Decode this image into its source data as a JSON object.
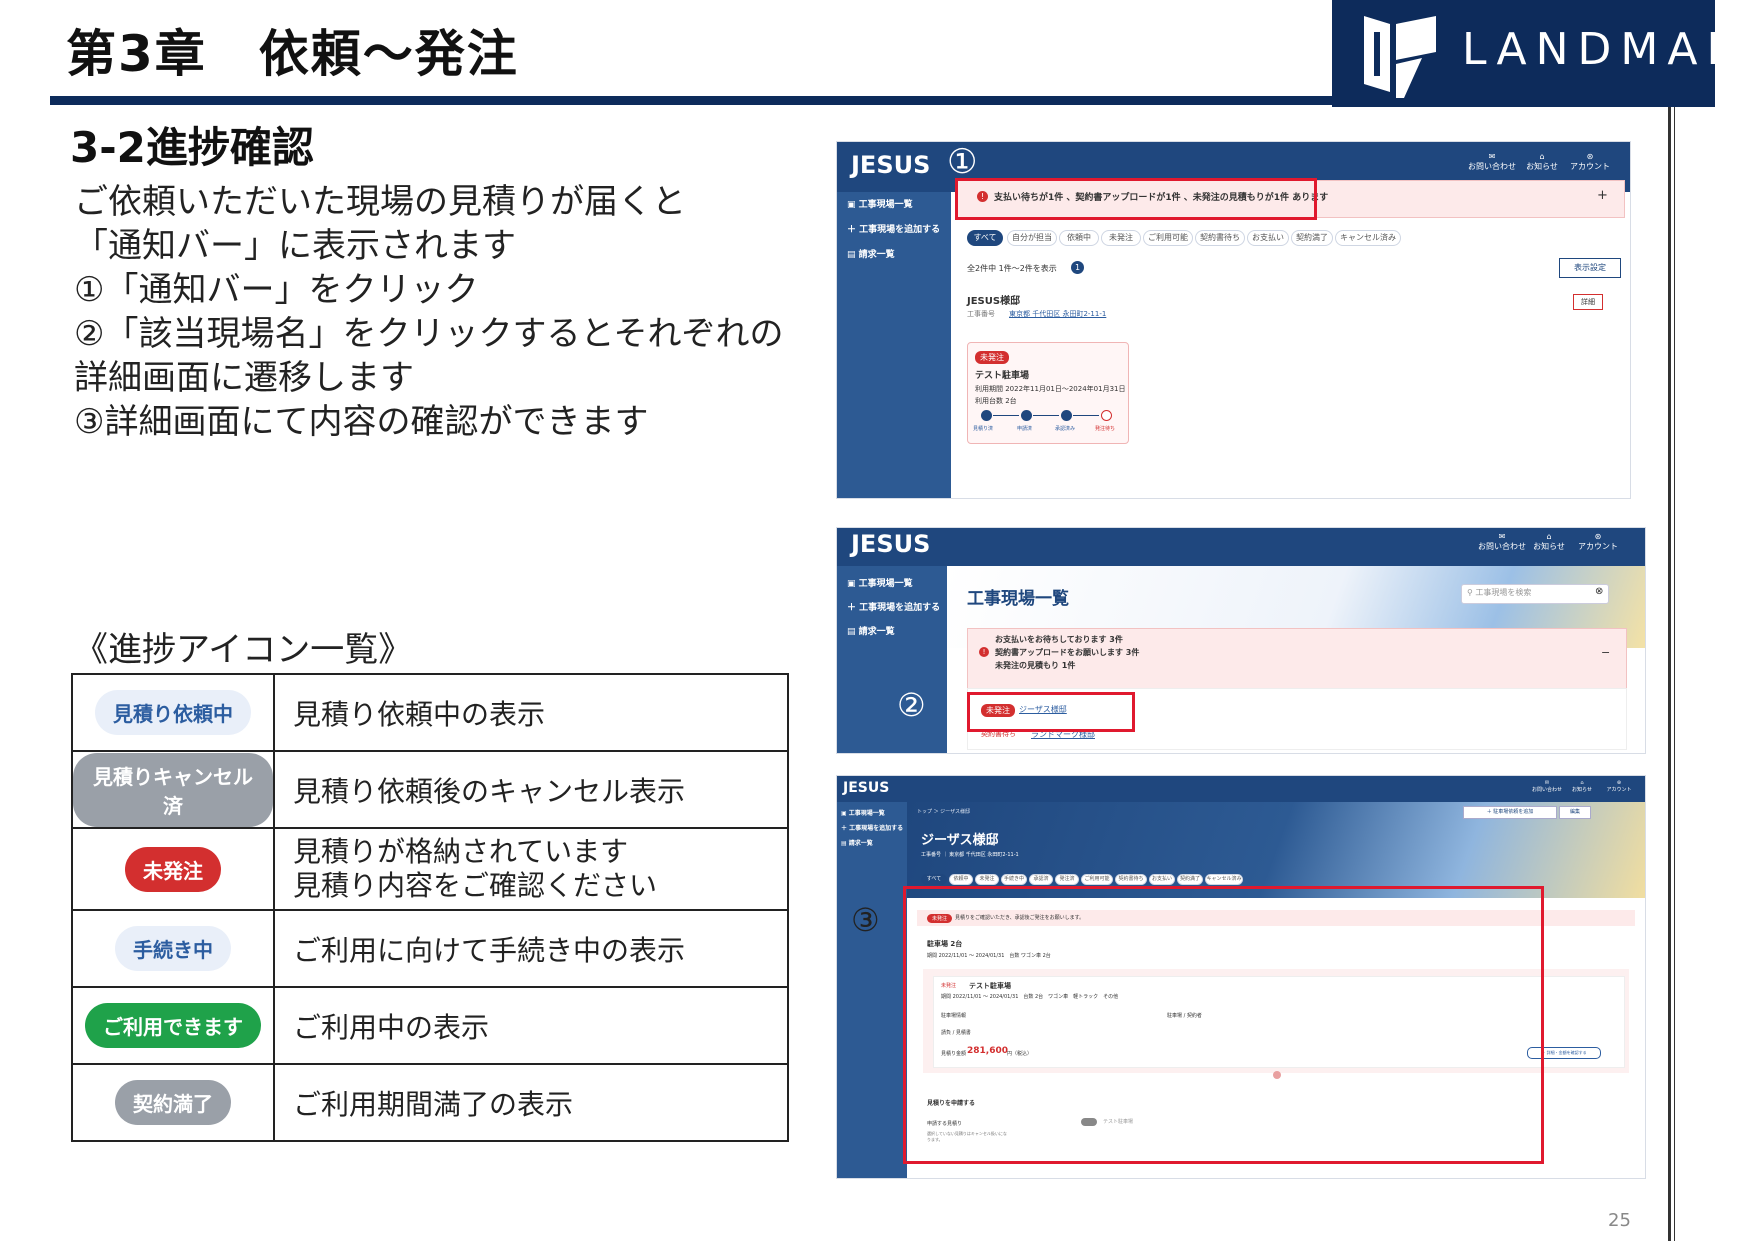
{
  "header": {
    "chapter_title": "第3章　依頼～発注",
    "logo_text": "LANDMARK",
    "logo_icon": "landmark-book-icon",
    "brand_color": "#0d2b5b"
  },
  "section_title": "3-2進捗確認",
  "description": [
    "ご依頼いただいた現場の見積りが届くと",
    "「通知バー」に表示されます",
    "①「通知バー」をクリック",
    "②「該当現場名」をクリックするとそれぞれの",
    "詳細画面に遷移します",
    "③詳細画面にて内容の確認ができます"
  ],
  "legend_title": "《進捗アイコン一覧》",
  "legend_rows": [
    {
      "badge": "見積り依頼中",
      "badge_color": "#eef3fb",
      "badge_text_color": "#2c5da0",
      "meaning": "見積り依頼中の表示"
    },
    {
      "badge": "見積りキャンセル済",
      "badge_color": "#9aa0a8",
      "badge_text_color": "#ffffff",
      "meaning": "見積り依頼後のキャンセル表示"
    },
    {
      "badge": "未発注",
      "badge_color": "#d32f2f",
      "badge_text_color": "#ffffff",
      "meaning": "見積りが格納されています",
      "meaning2": "見積り内容をご確認ください"
    },
    {
      "badge": "手続き中",
      "badge_color": "#eef3fb",
      "badge_text_color": "#2c5da0",
      "meaning": "ご利用に向けて手続き中の表示"
    },
    {
      "badge": "ご利用できます",
      "badge_color": "#1fa24a",
      "badge_text_color": "#ffffff",
      "meaning": "ご利用中の表示"
    },
    {
      "badge": "契約満了",
      "badge_color": "#9aa0a8",
      "badge_text_color": "#ffffff",
      "meaning": "ご利用期間満了の表示"
    }
  ],
  "screens": {
    "brand": "JESUS",
    "nav_contact": "お問い合わせ",
    "nav_notice": "お知らせ",
    "nav_account": "アカウント",
    "side_items": [
      "工事現場一覧",
      "工事現場を追加する",
      "請求一覧"
    ],
    "screen1": {
      "step_marker": "①",
      "notification": "支払い待ちが1件 、契約書アップロードが1件 、未発注の見積もりが1件 あります",
      "plus": "+",
      "tabs": [
        "すべて",
        "自分が担当",
        "依頼中",
        "未発注",
        "ご利用可能",
        "契約書待ち",
        "お支払い",
        "契約満了",
        "キャンセル済み"
      ],
      "count_text": "全2件中 1件～2件を表示",
      "count_badge": "1",
      "display_settings": "表示設定",
      "site_name": "JESUS様邸",
      "site_no_label": "工事番号",
      "site_address": "東京都 千代田区 永田町2-11-1",
      "detail_button": "詳細",
      "card_badge": "未発注",
      "card_title": "テスト駐車場",
      "card_period": "利用期間 2022年11月01日～2024年01月31日",
      "card_count": "利用台数 2台",
      "steps": [
        "見積り済",
        "申請済",
        "承認済み",
        "発注待ち"
      ]
    },
    "screen2": {
      "step_marker": "②",
      "page_title": "工事現場一覧",
      "search_placeholder": "工事現場を検索",
      "notice_lines": [
        "お支払いをお待ちしております 3件",
        "契約書アップロードをお願いします 3件",
        "未発注の見積もり 1件"
      ],
      "collapse": "−",
      "row1_badge": "未発注",
      "row1_site": "ジーザス様邸",
      "row2_badge": "契約書待ち",
      "row2_site": "ランドマーク様邸"
    },
    "screen3": {
      "step_marker": "③",
      "breadcrumb": "トップ ＞ ジーザス様邸",
      "btn_add": "＋ 駐車場依頼を追加",
      "btn_edit": "編集",
      "page_title": "ジーザス様邸",
      "sub_info": "工事番号 ｜ 東京都 千代田区 永田町2-11-1",
      "tabs": [
        "すべて",
        "依頼中",
        "未発注",
        "手続き中",
        "承認済",
        "発注済",
        "ご利用可能",
        "契約書待ち",
        "お支払い",
        "契約満了",
        "キャンセル済み"
      ],
      "alert_badge": "未発注",
      "alert_text": "見積りをご確認いただき、承認後ご発注をお願いします。",
      "req_title": "駐車場 2台",
      "req_dates": "期間 2022/11/01 ～ 2024/01/31　台数 ワゴン車 2台",
      "quote_badge": "未発注",
      "quote_title": "テスト駐車場",
      "quote_detail": "期間 2022/11/01 ～ 2024/01/31　台数 2台　ワゴン車　軽トラック　その他",
      "field1": "駐車場情報",
      "field2": "駐車場 / 契約者",
      "field3": "請負 / 見積書",
      "total_label": "見積り金額",
      "total_value": "281,600",
      "total_unit": "円（税込）",
      "detail_link": "＋ 詳細・金額を確認する",
      "apply_title": "見積りを申請する",
      "apply_label": "申請する見積り",
      "apply_note": "選択していない見積りはキャンセル扱いになります。",
      "toggle_label": "テスト駐車場"
    }
  },
  "page_number": "25"
}
